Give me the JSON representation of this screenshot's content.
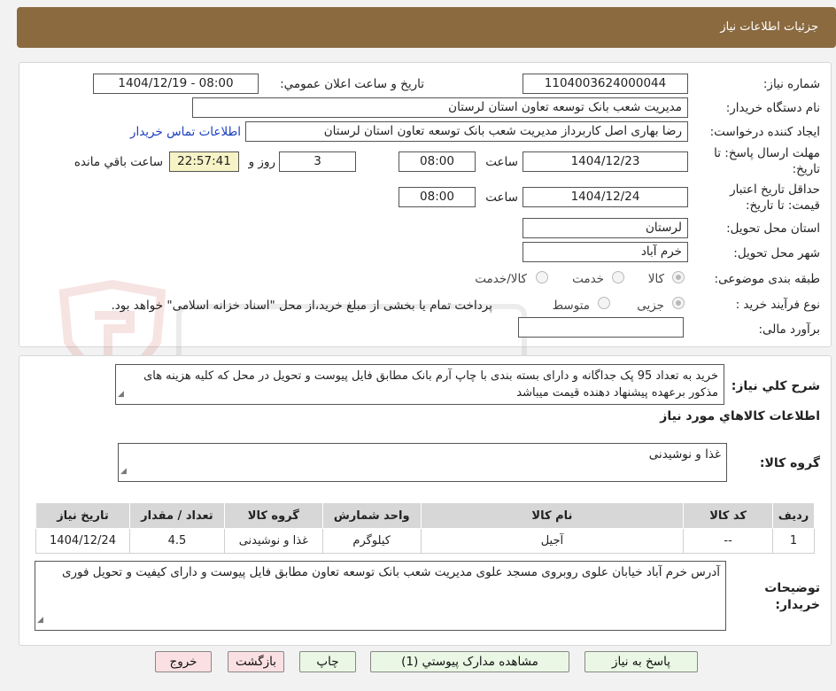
{
  "header": {
    "title": "جزئیات اطلاعات نیاز"
  },
  "form": {
    "need_number_label": "شماره نیاز:",
    "need_number": "1104003624000044",
    "announce_label": "تاریخ و ساعت اعلان عمومي:",
    "announce_value": "1404/12/19 - 08:00",
    "buyer_org_label": "نام دستگاه خريدار:",
    "buyer_org": "مدیریت شعب بانک توسعه تعاون استان لرستان",
    "requester_label": "ایجاد کننده درخواست:",
    "requester": "رضا بهاری اصل کاربرداز مدیریت شعب بانک توسعه تعاون استان لرستان",
    "contact_link": "اطلاعات تماس خریدار",
    "deadline_label_1": "مهلت ارسال پاسخ: تا",
    "deadline_label_2": "تاریخ:",
    "deadline_date": "1404/12/23",
    "time_label": "ساعت",
    "deadline_time": "08:00",
    "days_value": "3",
    "days_label": "روز و",
    "remaining_time": "22:57:41",
    "remaining_label": "ساعت باقي مانده",
    "validity_label_1": "حداقل تاریخ اعتبار",
    "validity_label_2": "قیمت: تا تاریخ:",
    "validity_date": "1404/12/24",
    "validity_time": "08:00",
    "province_label": "استان محل تحویل:",
    "province": "لرستان",
    "city_label": "شهر محل تحویل:",
    "city": "خرم آباد",
    "category_label": "طبقه بندی موضوعی:",
    "category_options": [
      "کالا",
      "خدمت",
      "کالا/خدمت"
    ],
    "purchase_type_label": "نوع فرآیند خرید :",
    "purchase_options": [
      "جزیی",
      "متوسط"
    ],
    "purchase_note": "پرداخت تمام یا بخشی از مبلغ خرید،از محل \"اسناد خزانه اسلامی\" خواهد بود.",
    "budget_label": "برآورد مالی:",
    "budget_value": ""
  },
  "description": {
    "label": "شرح کلي نياز:",
    "text": "خرید به تعداد 95 پک جداگانه و دارای بسته بندی با چاپ آرم بانک مطابق فایل پیوست و تحویل در محل که کلیه هزینه های مذکور برعهده پیشنهاد دهنده قیمت میباشد"
  },
  "goods": {
    "section_title": "اطلاعات کالاهاي مورد نياز",
    "group_label": "گروه کالا:",
    "group_value": "غذا و نوشیدنی",
    "columns": [
      "رديف",
      "کد کالا",
      "نام کالا",
      "واحد شمارش",
      "گروه کالا",
      "تعداد / مقدار",
      "تاریخ نیاز"
    ],
    "rows": [
      [
        "1",
        "--",
        "آجیل",
        "کیلوگرم",
        "غذا و نوشیدنی",
        "4.5",
        "1404/12/24"
      ]
    ]
  },
  "buyer_notes": {
    "label_1": "توضیحات",
    "label_2": "خریدار:",
    "text": "آدرس خرم آباد خیابان علوی روبروی مسجد علوی مدیریت شعب بانک توسعه تعاون مطابق فایل پیوست و دارای کیفیت و تحویل فوری"
  },
  "buttons": {
    "reply": "پاسخ به نیاز",
    "attachments": "مشاهده مدارک پیوستي (1)",
    "print": "چاپ",
    "back": "بازگشت",
    "exit": "خروج"
  },
  "colors": {
    "header": "#8b6a40",
    "remaining_bg": "#f6f3c6",
    "link": "#1a3fbf"
  }
}
